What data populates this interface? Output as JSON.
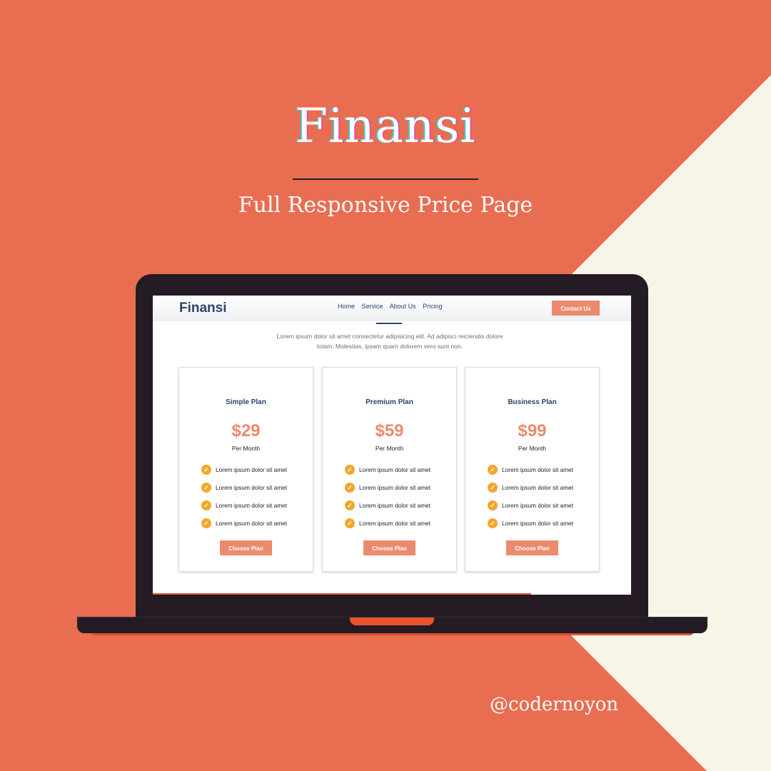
{
  "poster": {
    "title": "Finansi",
    "subtitle": "Full Responsive Price Page",
    "handle": "@codernoyon"
  },
  "colors": {
    "brand": "#E96D50",
    "cream": "#F6F5E8",
    "accent": "#EC8A6E",
    "navy": "#2c4470",
    "check": "#F4A62A"
  },
  "site": {
    "logo": "Finansi",
    "nav": [
      "Home",
      "Service",
      "About Us",
      "Pricing"
    ],
    "contact_label": "Contact Us",
    "description": "Lorem ipsum dolor sit amet consectetur adipisicing elit. Ad adipisci reiciendis dolore totam. Molestias, ipsam quam dolorem vero sunt non."
  },
  "plans": [
    {
      "name": "Simple Plan",
      "price": "$29",
      "period": "Per Month",
      "features": [
        "Lorem ipsum dolor sit amet",
        "Lorem ipsum dolor sit amet",
        "Lorem ipsum dolor sit amet",
        "Lorem ipsum dolor sit amet"
      ],
      "cta": "Choose Plan"
    },
    {
      "name": "Premium Plan",
      "price": "$59",
      "period": "Per Month",
      "features": [
        "Lorem ipsum dolor sit amet",
        "Lorem ipsum dolor sit amet",
        "Lorem ipsum dolor sit amet",
        "Lorem ipsum dolor sit amet"
      ],
      "cta": "Choose Plan"
    },
    {
      "name": "Business Plan",
      "price": "$99",
      "period": "Per Month",
      "features": [
        "Lorem ipsum dolor sit amet",
        "Lorem ipsum dolor sit amet",
        "Lorem ipsum dolor sit amet",
        "Lorem ipsum dolor sit amet"
      ],
      "cta": "Choose Plan"
    }
  ],
  "icons": {
    "feature": "check-circle-icon"
  }
}
